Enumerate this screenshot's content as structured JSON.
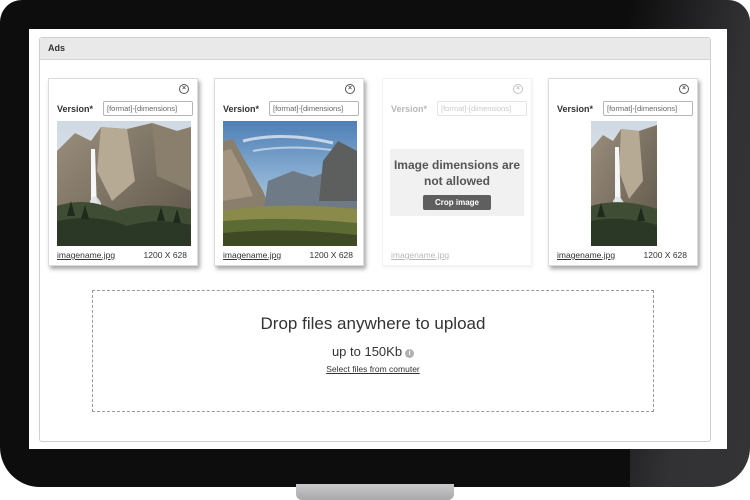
{
  "panel": {
    "title": "Ads"
  },
  "cards": [
    {
      "version_label": "Version*",
      "placeholder": "[format]-[dimensions]",
      "file_name": "imagename.jpg",
      "dimensions": "1200 X 628",
      "image": "waterfall-valley"
    },
    {
      "version_label": "Version*",
      "placeholder": "[format]-[dimensions]",
      "file_name": "imagename.jpg",
      "dimensions": "1200 X 628",
      "image": "valley-vista"
    },
    {
      "version_label": "Version*",
      "placeholder": "[format]-[dimensions]",
      "file_name": "imagename.jpg",
      "dimensions": "",
      "message": "Image dimensions are not allowed",
      "crop_label": "Crop image"
    },
    {
      "version_label": "Version*",
      "placeholder": "[format]-[dimensions]",
      "file_name": "imagename.jpg",
      "dimensions": "1200 X 628",
      "image": "waterfall-valley-cropped"
    }
  ],
  "dropzone": {
    "title": "Drop files anywhere to upload",
    "limit": "up to 150Kb",
    "select_label": "Select files from comuter"
  },
  "icons": {
    "close": "close-circle-icon",
    "info": "info-icon"
  },
  "colors": {
    "bezel": "#0d0d0e",
    "panel_header": "#e9e9e9",
    "crop_button": "#5f5f5f"
  }
}
